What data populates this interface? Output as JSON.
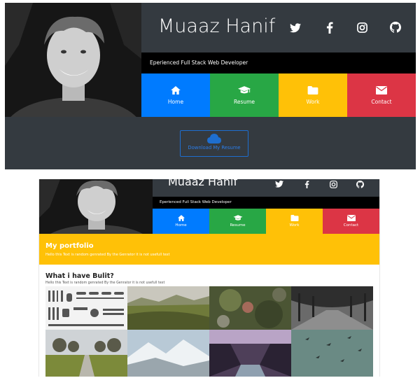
{
  "top": {
    "name": "Muaaz Hanif",
    "subtitle": "Eperienced Full Stack Web Developer",
    "socials": [
      "twitter-icon",
      "facebook-icon",
      "instagram-icon",
      "github-icon"
    ],
    "tiles": [
      {
        "label": "Home",
        "icon": "home-icon",
        "color": "#007bff"
      },
      {
        "label": "Resume",
        "icon": "graduation-cap-icon",
        "color": "#28a745"
      },
      {
        "label": "Work",
        "icon": "folder-icon",
        "color": "#ffc107"
      },
      {
        "label": "Contact",
        "icon": "envelope-icon",
        "color": "#dc3545"
      }
    ],
    "download_label": "Download My Resume",
    "download_icon": "cloud-icon"
  },
  "bottom": {
    "name": "Muaaz Hanif",
    "subtitle": "Eperienced Full Stack Web Developer",
    "tiles": [
      {
        "label": "Home",
        "icon": "home-icon",
        "color": "#007bff"
      },
      {
        "label": "Resume",
        "icon": "graduation-cap-icon",
        "color": "#28a745"
      },
      {
        "label": "Work",
        "icon": "folder-icon",
        "color": "#ffc107"
      },
      {
        "label": "Contact",
        "icon": "envelope-icon",
        "color": "#dc3545"
      }
    ],
    "portfolio_title": "My portfolio",
    "portfolio_text": "Hello this Text is random genrated By the Genrator it is not usefull text",
    "built_title": "What i have Bulit?",
    "built_text": "Hello this Text is random genrated By the Genrator it is not usefull text"
  },
  "colors": {
    "dark": "#343a40",
    "black": "#000000",
    "primary": "#007bff",
    "success": "#28a745",
    "warning": "#ffc107",
    "danger": "#dc3545"
  }
}
